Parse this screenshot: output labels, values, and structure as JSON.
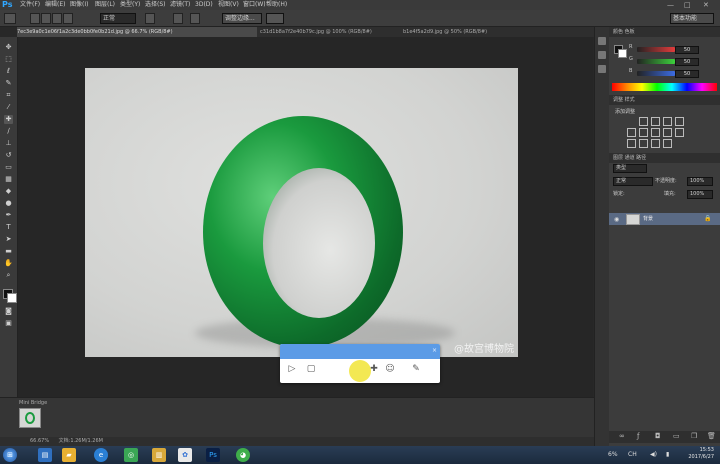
{
  "app": {
    "logo": "Ps"
  },
  "menu": {
    "items": [
      "文件(F)",
      "编辑(E)",
      "图像(I)",
      "图层(L)",
      "类型(Y)",
      "选择(S)",
      "滤镜(T)",
      "3D(D)",
      "视图(V)",
      "窗口(W)",
      "帮助(H)"
    ]
  },
  "window_controls": {
    "minimize": "—",
    "maximize": "□",
    "close": "✕"
  },
  "options": {
    "feather_label": "羽化:",
    "feather_value": "0 像素",
    "style_value": "正常",
    "refine_edge": "调整边缘...",
    "workspace": "基本功能"
  },
  "tabs": [
    {
      "label": "7ec3e9a0c1e06f1a2c3de0bb0fe0b21d.jpg @ 66.7% (RGB/8#)",
      "active": true
    },
    {
      "label": "c31d1b8a7f2e40b79c.jpg @ 100% (RGB/8#)",
      "active": false
    },
    {
      "label": "b1e4f5a2d9.jpg @ 50% (RGB/8#)",
      "active": false
    }
  ],
  "canvas": {
    "watermark": "@故宫博物院"
  },
  "recorder": {
    "close_icon": "×",
    "icons": [
      "play-icon",
      "stop-icon",
      "pen-icon",
      "user-icon",
      "edit-icon"
    ]
  },
  "panels": {
    "color_tabs": "颜色  色板",
    "sliders": [
      {
        "label": "R",
        "value": "50",
        "color": "#e33c3c"
      },
      {
        "label": "G",
        "value": "50",
        "color": "#3cd13c"
      },
      {
        "label": "B",
        "value": "50",
        "color": "#3c6ce3"
      }
    ],
    "adjust_tabs": "调整  样式",
    "adjust_title": "添加调整",
    "layer_tabs": "图层  通道  路径",
    "layer_kind": "类型",
    "layer_mode": "正常",
    "opacity_label": "不透明度:",
    "opacity_value": "100%",
    "lock_label": "锁定:",
    "fill_label": "填充:",
    "fill_value": "100%",
    "layer_name": "背景"
  },
  "mini_bridge": {
    "label": "Mini Bridge"
  },
  "status": {
    "zoom": "66.67%",
    "doc": "文档:1.26M/1.26M"
  },
  "taskbar": {
    "tray_text": "CH",
    "time": "15:53",
    "date": "2017/6/27",
    "tray_percent": "6%"
  },
  "colors": {
    "accent": "#5b9be6",
    "jade": "#1a9a3e",
    "cursor": "#f2e640"
  }
}
